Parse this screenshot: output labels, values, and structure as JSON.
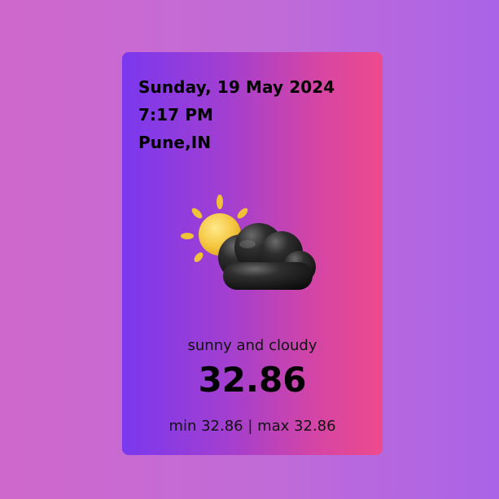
{
  "weather_card": {
    "date": "Sunday, 19 May 2024",
    "time": "7:17 PM",
    "location": "Pune,IN",
    "icon": "partly-cloudy-icon",
    "description": "sunny and cloudy",
    "temperature": "32.86",
    "range": "min 32.86 | max 32.86"
  },
  "colors": {
    "background_left": "#cf68cc",
    "background_right": "#aa63e6",
    "card_left": "#7a38ee",
    "card_right": "#ee4a8d",
    "sun": "#f5c842",
    "cloud": "#1f1f1f"
  }
}
